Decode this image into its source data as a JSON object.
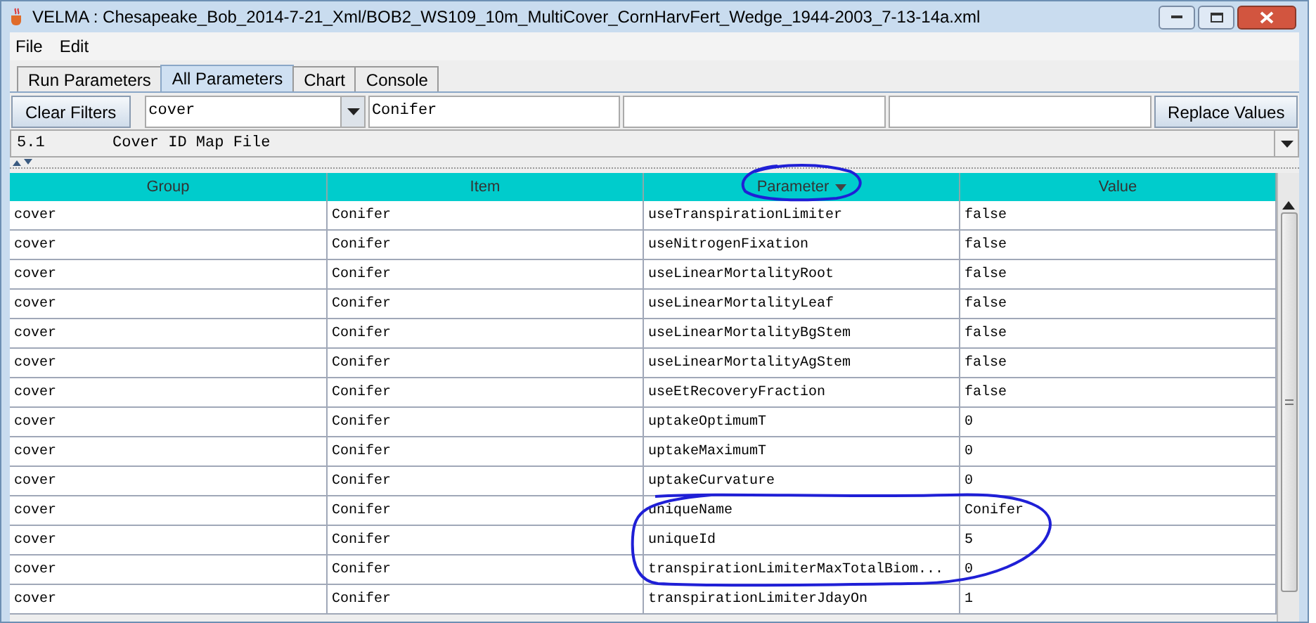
{
  "window": {
    "title": "VELMA : Chesapeake_Bob_2014-7-21_Xml/BOB2_WS109_10m_MultiCover_CornHarvFert_Wedge_1944-2003_7-13-14a.xml"
  },
  "menu": [
    "File",
    "Edit"
  ],
  "tabs": [
    {
      "label": "Run Parameters",
      "selected": false
    },
    {
      "label": "All Parameters",
      "selected": true
    },
    {
      "label": "Chart",
      "selected": false
    },
    {
      "label": "Console",
      "selected": false
    }
  ],
  "filters": {
    "clear_button": "Clear Filters",
    "group_filter": "cover",
    "item_filter": "Conifer",
    "replace_button": "Replace Values"
  },
  "info_line": {
    "number": "5.1",
    "text": "Cover ID Map File"
  },
  "table": {
    "columns": [
      {
        "label": "Group",
        "sorted": false
      },
      {
        "label": "Item",
        "sorted": false
      },
      {
        "label": "Parameter",
        "sorted": true
      },
      {
        "label": "Value",
        "sorted": false
      }
    ],
    "rows": [
      [
        "cover",
        "Conifer",
        "useTranspirationLimiter",
        "false"
      ],
      [
        "cover",
        "Conifer",
        "useNitrogenFixation",
        "false"
      ],
      [
        "cover",
        "Conifer",
        "useLinearMortalityRoot",
        "false"
      ],
      [
        "cover",
        "Conifer",
        "useLinearMortalityLeaf",
        "false"
      ],
      [
        "cover",
        "Conifer",
        "useLinearMortalityBgStem",
        "false"
      ],
      [
        "cover",
        "Conifer",
        "useLinearMortalityAgStem",
        "false"
      ],
      [
        "cover",
        "Conifer",
        "useEtRecoveryFraction",
        "false"
      ],
      [
        "cover",
        "Conifer",
        "uptakeOptimumT",
        "0"
      ],
      [
        "cover",
        "Conifer",
        "uptakeMaximumT",
        "0"
      ],
      [
        "cover",
        "Conifer",
        "uptakeCurvature",
        "0"
      ],
      [
        "cover",
        "Conifer",
        "uniqueName",
        "Conifer"
      ],
      [
        "cover",
        "Conifer",
        "uniqueId",
        "5"
      ],
      [
        "cover",
        "Conifer",
        "transpirationLimiterMaxTotalBiom...",
        "0"
      ],
      [
        "cover",
        "Conifer",
        "transpirationLimiterJdayOn",
        "1"
      ]
    ]
  }
}
